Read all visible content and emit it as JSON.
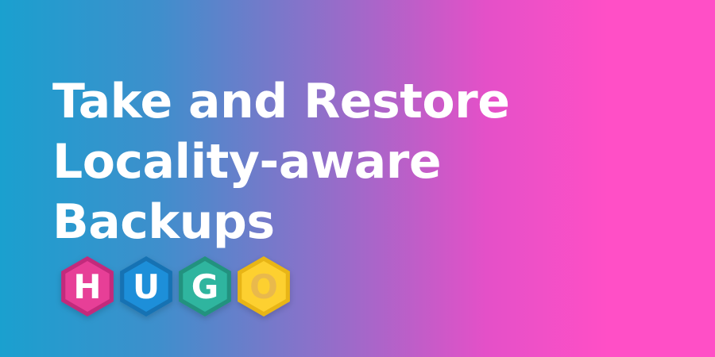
{
  "headline": {
    "line1": "Take and Restore",
    "line2": "Locality-aware",
    "line3": "Backups"
  },
  "logo": {
    "name": "hugo-logo",
    "letters": [
      {
        "letter": "H",
        "fill": "#e73f97",
        "stroke": "#c22a7c",
        "text_color": "#ffffff"
      },
      {
        "letter": "U",
        "fill": "#1d8fd9",
        "stroke": "#1572b3",
        "text_color": "#ffffff"
      },
      {
        "letter": "G",
        "fill": "#2fb59f",
        "stroke": "#23927f",
        "text_color": "#ffffff"
      },
      {
        "letter": "O",
        "fill": "#fdd030",
        "stroke": "#e8b512",
        "text_color": "#e9b94c"
      }
    ]
  },
  "colors": {
    "gradient_start": "#1aa0cf",
    "gradient_end": "#ff4fc6",
    "headline": "#ffffff"
  }
}
